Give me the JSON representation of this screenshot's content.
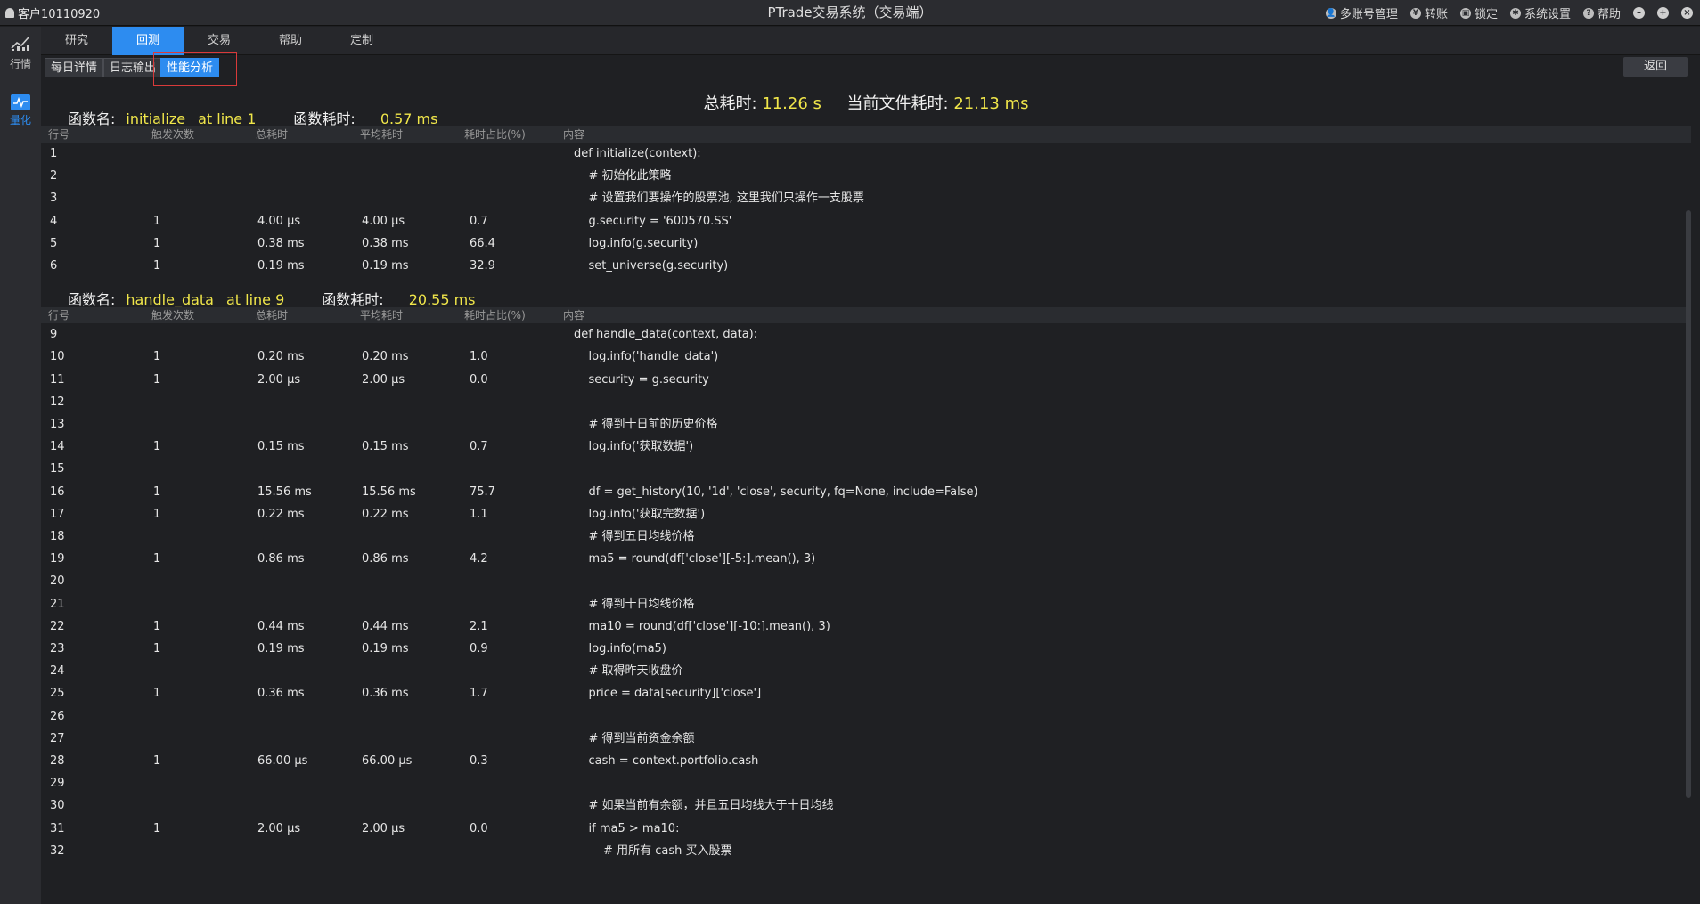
{
  "titlebar": {
    "customer": "客户10110920",
    "title": "PTrade交易系统（交易端）",
    "right_items": [
      "多账号管理",
      "转账",
      "锁定",
      "系统设置",
      "帮助"
    ]
  },
  "sidebar": {
    "items": [
      {
        "label": "行情",
        "icon": "chart-line-icon"
      },
      {
        "label": "量化",
        "icon": "quant-icon"
      }
    ]
  },
  "tabs": [
    "研究",
    "回测",
    "交易",
    "帮助",
    "定制"
  ],
  "active_tab": "回测",
  "subtabs": [
    "每日详情",
    "日志输出",
    "性能分析"
  ],
  "active_subtab": "性能分析",
  "return_label": "返回",
  "summary": {
    "total_label": "总耗时:",
    "total_value": "11.26 s",
    "file_label": "当前文件耗时:",
    "file_value": "21.13 ms"
  },
  "columns": [
    "行号",
    "触发次数",
    "总耗时",
    "平均耗时",
    "耗时占比(%)",
    "内容"
  ],
  "functions": [
    {
      "name_label": "函数名:",
      "name": "initialize",
      "line": "at line 1",
      "time_label": "函数耗时:",
      "time": "0.57 ms",
      "rows": [
        [
          "1",
          "",
          "",
          "",
          "",
          "def initialize(context):"
        ],
        [
          "2",
          "",
          "",
          "",
          "",
          "    # 初始化此策略"
        ],
        [
          "3",
          "",
          "",
          "",
          "",
          "    # 设置我们要操作的股票池, 这里我们只操作一支股票"
        ],
        [
          "4",
          "1",
          "4.00 µs",
          "4.00 µs",
          "0.7",
          "    g.security = '600570.SS'"
        ],
        [
          "5",
          "1",
          "0.38 ms",
          "0.38 ms",
          "66.4",
          "    log.info(g.security)"
        ],
        [
          "6",
          "1",
          "0.19 ms",
          "0.19 ms",
          "32.9",
          "    set_universe(g.security)"
        ]
      ]
    },
    {
      "name_label": "函数名:",
      "name": "handle_data",
      "line": "at line 9",
      "time_label": "函数耗时:",
      "time": "20.55 ms",
      "rows": [
        [
          "9",
          "",
          "",
          "",
          "",
          "def handle_data(context, data):"
        ],
        [
          "10",
          "1",
          "0.20 ms",
          "0.20 ms",
          "1.0",
          "    log.info('handle_data')"
        ],
        [
          "11",
          "1",
          "2.00 µs",
          "2.00 µs",
          "0.0",
          "    security = g.security"
        ],
        [
          "12",
          "",
          "",
          "",
          "",
          ""
        ],
        [
          "13",
          "",
          "",
          "",
          "",
          "    # 得到十日前的历史价格"
        ],
        [
          "14",
          "1",
          "0.15 ms",
          "0.15 ms",
          "0.7",
          "    log.info('获取数据')"
        ],
        [
          "15",
          "",
          "",
          "",
          "",
          ""
        ],
        [
          "16",
          "1",
          "15.56 ms",
          "15.56 ms",
          "75.7",
          "    df = get_history(10, '1d', 'close', security, fq=None, include=False)"
        ],
        [
          "17",
          "1",
          "0.22 ms",
          "0.22 ms",
          "1.1",
          "    log.info('获取完数据')"
        ],
        [
          "18",
          "",
          "",
          "",
          "",
          "    # 得到五日均线价格"
        ],
        [
          "19",
          "1",
          "0.86 ms",
          "0.86 ms",
          "4.2",
          "    ma5 = round(df['close'][-5:].mean(), 3)"
        ],
        [
          "20",
          "",
          "",
          "",
          "",
          ""
        ],
        [
          "21",
          "",
          "",
          "",
          "",
          "    # 得到十日均线价格"
        ],
        [
          "22",
          "1",
          "0.44 ms",
          "0.44 ms",
          "2.1",
          "    ma10 = round(df['close'][-10:].mean(), 3)"
        ],
        [
          "23",
          "1",
          "0.19 ms",
          "0.19 ms",
          "0.9",
          "    log.info(ma5)"
        ],
        [
          "24",
          "",
          "",
          "",
          "",
          "    # 取得昨天收盘价"
        ],
        [
          "25",
          "1",
          "0.36 ms",
          "0.36 ms",
          "1.7",
          "    price = data[security]['close']"
        ],
        [
          "26",
          "",
          "",
          "",
          "",
          ""
        ],
        [
          "27",
          "",
          "",
          "",
          "",
          "    # 得到当前资金余额"
        ],
        [
          "28",
          "1",
          "66.00 µs",
          "66.00 µs",
          "0.3",
          "    cash = context.portfolio.cash"
        ],
        [
          "29",
          "",
          "",
          "",
          "",
          ""
        ],
        [
          "30",
          "",
          "",
          "",
          "",
          "    # 如果当前有余额，并且五日均线大于十日均线"
        ],
        [
          "31",
          "1",
          "2.00 µs",
          "2.00 µs",
          "0.0",
          "    if ma5 > ma10:"
        ],
        [
          "32",
          "",
          "",
          "",
          "",
          "        # 用所有 cash 买入股票"
        ]
      ]
    }
  ]
}
